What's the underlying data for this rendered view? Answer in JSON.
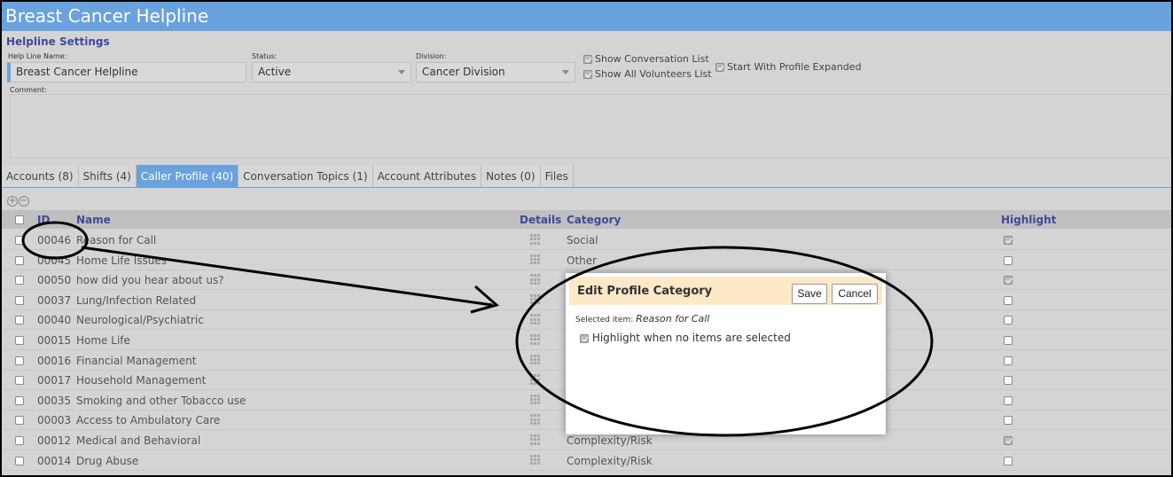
{
  "app": {
    "title": "Breast Cancer Helpline"
  },
  "settings": {
    "heading": "Helpline Settings",
    "name_label": "Help Line Name:",
    "name_value": "Breast Cancer Helpline",
    "status_label": "Status:",
    "status_value": "Active",
    "division_label": "Division:",
    "division_value": "Cancer Division",
    "show_conversation_list": "Show Conversation List",
    "show_all_volunteers_list": "Show All Volunteers List",
    "start_with_profile_expanded": "Start With Profile Expanded",
    "comment_label": "Comment:"
  },
  "tabs": [
    {
      "label": "Accounts (8)",
      "active": false
    },
    {
      "label": "Shifts (4)",
      "active": false
    },
    {
      "label": "Caller Profile (40)",
      "active": true
    },
    {
      "label": "Conversation Topics (1)",
      "active": false
    },
    {
      "label": "Account Attributes",
      "active": false
    },
    {
      "label": "Notes (0)",
      "active": false
    },
    {
      "label": "Files",
      "active": false
    }
  ],
  "grid": {
    "columns": {
      "id": "ID",
      "name": "Name",
      "details": "Details",
      "category": "Category",
      "highlight": "Highlight"
    },
    "rows": [
      {
        "id": "00046",
        "name": "Reason for Call",
        "category": "Social",
        "highlight": true
      },
      {
        "id": "00045",
        "name": "Home Life Issues",
        "category": "Other",
        "highlight": false
      },
      {
        "id": "00050",
        "name": "how did you hear about us?",
        "category": "",
        "highlight": true
      },
      {
        "id": "00037",
        "name": "Lung/Infection Related",
        "category": "",
        "highlight": false
      },
      {
        "id": "00040",
        "name": "Neurological/Psychiatric",
        "category": "",
        "highlight": false
      },
      {
        "id": "00015",
        "name": "Home Life",
        "category": "",
        "highlight": false
      },
      {
        "id": "00016",
        "name": "Financial Management",
        "category": "",
        "highlight": false
      },
      {
        "id": "00017",
        "name": "Household Management",
        "category": "",
        "highlight": false
      },
      {
        "id": "00035",
        "name": "Smoking and other Tobacco use",
        "category": "",
        "highlight": false
      },
      {
        "id": "00003",
        "name": "Access to Ambulatory Care",
        "category": "",
        "highlight": false
      },
      {
        "id": "00012",
        "name": "Medical and Behavioral",
        "category": "Complexity/Risk",
        "highlight": true
      },
      {
        "id": "00014",
        "name": "Drug Abuse",
        "category": "Complexity/Risk",
        "highlight": false
      }
    ]
  },
  "dialog": {
    "title": "Edit Profile Category",
    "save_label": "Save",
    "cancel_label": "Cancel",
    "selected_prefix": "Selected item:",
    "selected_value": "Reason for Call",
    "highlight_label": "Highlight when no items are selected"
  },
  "icons": {
    "add": "plus-circle-icon",
    "remove": "minus-circle-icon",
    "details": "grid-icon"
  },
  "colors": {
    "accent": "#69a2dd",
    "heading": "#3e4a9c",
    "dialog_header": "#fde8c8"
  }
}
